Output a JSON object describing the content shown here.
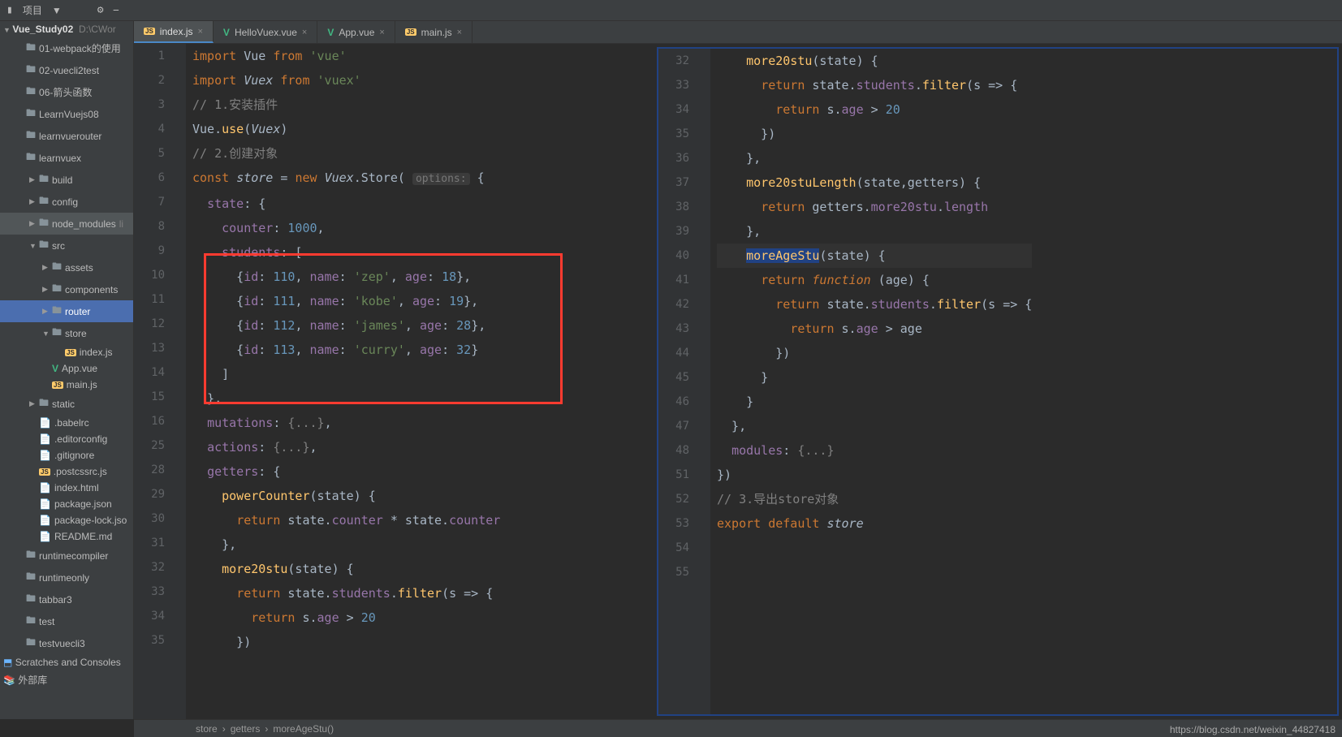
{
  "toolbar": {
    "project_label": "项目",
    "arrow": "▼"
  },
  "project": {
    "root_name": "Vue_Study02",
    "root_path": "D:\\CWor",
    "items": [
      {
        "name": "01-webpack的使用",
        "type": "folder",
        "level": 1
      },
      {
        "name": "02-vuecli2test",
        "type": "folder",
        "level": 1
      },
      {
        "name": "06-箭头函数",
        "type": "folder",
        "level": 1
      },
      {
        "name": "LearnVuejs08",
        "type": "folder",
        "level": 1
      },
      {
        "name": "learnvuerouter",
        "type": "folder",
        "level": 1
      },
      {
        "name": "learnvuex",
        "type": "folder",
        "level": 1,
        "open": true
      },
      {
        "name": "build",
        "type": "folder",
        "level": 2,
        "arrow": true
      },
      {
        "name": "config",
        "type": "folder",
        "level": 2,
        "arrow": true
      },
      {
        "name": "node_modules",
        "type": "folder",
        "level": 2,
        "arrow": true,
        "special": "node"
      },
      {
        "name": "src",
        "type": "folder",
        "level": 2,
        "arrow": true,
        "open": true
      },
      {
        "name": "assets",
        "type": "folder",
        "level": 3,
        "arrow": true
      },
      {
        "name": "components",
        "type": "folder",
        "level": 3,
        "arrow": true
      },
      {
        "name": "router",
        "type": "folder",
        "level": 3,
        "arrow": true,
        "selected": true
      },
      {
        "name": "store",
        "type": "folder",
        "level": 3,
        "arrow": true,
        "open": true
      },
      {
        "name": "index.js",
        "type": "js",
        "level": 4
      },
      {
        "name": "App.vue",
        "type": "vue",
        "level": 3
      },
      {
        "name": "main.js",
        "type": "js",
        "level": 3
      },
      {
        "name": "static",
        "type": "folder",
        "level": 2,
        "arrow": true
      },
      {
        "name": ".babelrc",
        "type": "file",
        "level": 2
      },
      {
        "name": ".editorconfig",
        "type": "file",
        "level": 2
      },
      {
        "name": ".gitignore",
        "type": "file",
        "level": 2
      },
      {
        "name": ".postcssrc.js",
        "type": "js",
        "level": 2
      },
      {
        "name": "index.html",
        "type": "file",
        "level": 2
      },
      {
        "name": "package.json",
        "type": "file",
        "level": 2
      },
      {
        "name": "package-lock.jso",
        "type": "file",
        "level": 2
      },
      {
        "name": "README.md",
        "type": "file",
        "level": 2
      },
      {
        "name": "runtimecompiler",
        "type": "folder",
        "level": 1
      },
      {
        "name": "runtimeonly",
        "type": "folder",
        "level": 1
      },
      {
        "name": "tabbar3",
        "type": "folder",
        "level": 1
      },
      {
        "name": "test",
        "type": "folder",
        "level": 1
      },
      {
        "name": "testvuecli3",
        "type": "folder",
        "level": 1
      }
    ],
    "scratches": "Scratches and Consoles",
    "ext_lib": "外部库"
  },
  "tabs": [
    {
      "label": "index.js",
      "type": "js",
      "active": true
    },
    {
      "label": "HelloVuex.vue",
      "type": "vue"
    },
    {
      "label": "App.vue",
      "type": "vue"
    },
    {
      "label": "main.js",
      "type": "js"
    }
  ],
  "left_editor": {
    "line_nums": [
      "1",
      "2",
      "3",
      "4",
      "5",
      "6",
      "7",
      "8",
      "9",
      "10",
      "11",
      "12",
      "13",
      "14",
      "15",
      "16",
      "25",
      "28",
      "29",
      "30",
      "31",
      "32",
      "33",
      "34",
      "35"
    ],
    "code_lines": [
      {
        "h": "<span class='kw'>import</span> Vue <span class='kw'>from</span> <span class='str'>'vue'</span>"
      },
      {
        "h": "<span class='kw'>import</span> <span class='cls'>Vuex</span> <span class='kw'>from</span> <span class='str'>'vuex'</span>"
      },
      {
        "h": "<span class='com'>// 1.安装插件</span>"
      },
      {
        "h": "Vue.<span class='fn'>use</span>(<span class='cls'>Vuex</span>)"
      },
      {
        "h": "<span class='com'>// 2.创建对象</span>"
      },
      {
        "h": "<span class='kw'>const </span><span class='cls'>store</span> = <span class='kw'>new</span> <span class='cls'>Vuex</span>.Store( <span class='hint'>options:</span> {"
      },
      {
        "h": "  <span class='prop'>state</span>: {"
      },
      {
        "h": "    <span class='prop'>counter</span>: <span class='num'>1000</span>,"
      },
      {
        "h": "    <span class='prop'>students</span>: ["
      },
      {
        "h": "      {<span class='prop'>id</span>: <span class='num'>110</span>, <span class='prop'>name</span>: <span class='str'>'zep'</span>, <span class='prop'>age</span>: <span class='num'>18</span>},"
      },
      {
        "h": "      {<span class='prop'>id</span>: <span class='num'>111</span>, <span class='prop'>name</span>: <span class='str'>'kobe'</span>, <span class='prop'>age</span>: <span class='num'>19</span>},"
      },
      {
        "h": "      {<span class='prop'>id</span>: <span class='num'>112</span>, <span class='prop'>name</span>: <span class='str'>'james'</span>, <span class='prop'>age</span>: <span class='num'>28</span>},"
      },
      {
        "h": "      {<span class='prop'>id</span>: <span class='num'>113</span>, <span class='prop'>name</span>: <span class='str'>'curry'</span>, <span class='prop'>age</span>: <span class='num'>32</span>}"
      },
      {
        "h": "    ]"
      },
      {
        "h": "  },"
      },
      {
        "h": "  <span class='prop'>mutations</span>: <span class='com'>{...}</span>,"
      },
      {
        "h": "  <span class='prop'>actions</span>: <span class='com'>{...}</span>,"
      },
      {
        "h": "  <span class='prop'>getters</span>: {"
      },
      {
        "h": "    <span class='fn'>powerCounter</span>(state) {"
      },
      {
        "h": "      <span class='kw'>return</span> state.<span class='prop'>counter</span> * state.<span class='prop'>counter</span>"
      },
      {
        "h": "    },"
      },
      {
        "h": "    <span class='fn'>more20stu</span>(state) {"
      },
      {
        "h": "      <span class='kw'>return</span> state.<span class='prop'>students</span>.<span class='fn'>filter</span>(s =&gt; {"
      },
      {
        "h": "        <span class='kw'>return</span> s.<span class='prop'>age</span> &gt; <span class='num'>20</span>"
      },
      {
        "h": "      })"
      }
    ]
  },
  "right_editor": {
    "line_nums": [
      "32",
      "33",
      "34",
      "35",
      "36",
      "37",
      "38",
      "39",
      "40",
      "41",
      "42",
      "43",
      "44",
      "45",
      "46",
      "47",
      "48",
      "51",
      "52",
      "53",
      "54",
      "55"
    ],
    "code_lines": [
      {
        "h": "    <span class='fn'>more20stu</span>(state) {"
      },
      {
        "h": "      <span class='kw'>return</span> state.<span class='prop'>students</span>.<span class='fn'>filter</span>(s =&gt; {"
      },
      {
        "h": "        <span class='kw'>return</span> s.<span class='prop'>age</span> &gt; <span class='num'>20</span>"
      },
      {
        "h": "      })"
      },
      {
        "h": "    },"
      },
      {
        "h": "    <span class='fn'>more20stuLength</span>(state,getters) {"
      },
      {
        "h": "      <span class='kw'>return</span> getters.<span class='prop'>more20stu</span>.<span class='prop'>length</span>"
      },
      {
        "h": "    },"
      },
      {
        "h": "    <span class='sel-bg'><span class='fn'>moreAgeStu</span></span>(state) {",
        "hl": true
      },
      {
        "h": "      <span class='kw'>return</span> <span class='kw-i'>function</span> (age) {"
      },
      {
        "h": "        <span class='kw'>return</span> state.<span class='prop'>students</span>.<span class='fn'>filter</span>(s =&gt; {"
      },
      {
        "h": "          <span class='kw'>return</span> s.<span class='prop'>age</span> &gt; age"
      },
      {
        "h": "        })"
      },
      {
        "h": "      }"
      },
      {
        "h": "    }"
      },
      {
        "h": "  },"
      },
      {
        "h": "  <span class='prop'>modules</span>: <span class='com'>{...}</span>"
      },
      {
        "h": "})"
      },
      {
        "h": ""
      },
      {
        "h": "<span class='com'>// 3.导出store对象</span>"
      },
      {
        "h": "<span class='kw'>export default</span> <span class='cls'>store</span>"
      },
      {
        "h": ""
      }
    ]
  },
  "breadcrumb": [
    "store",
    "getters",
    "moreAgeStu()"
  ],
  "watermark": "https://blog.csdn.net/weixin_44827418"
}
